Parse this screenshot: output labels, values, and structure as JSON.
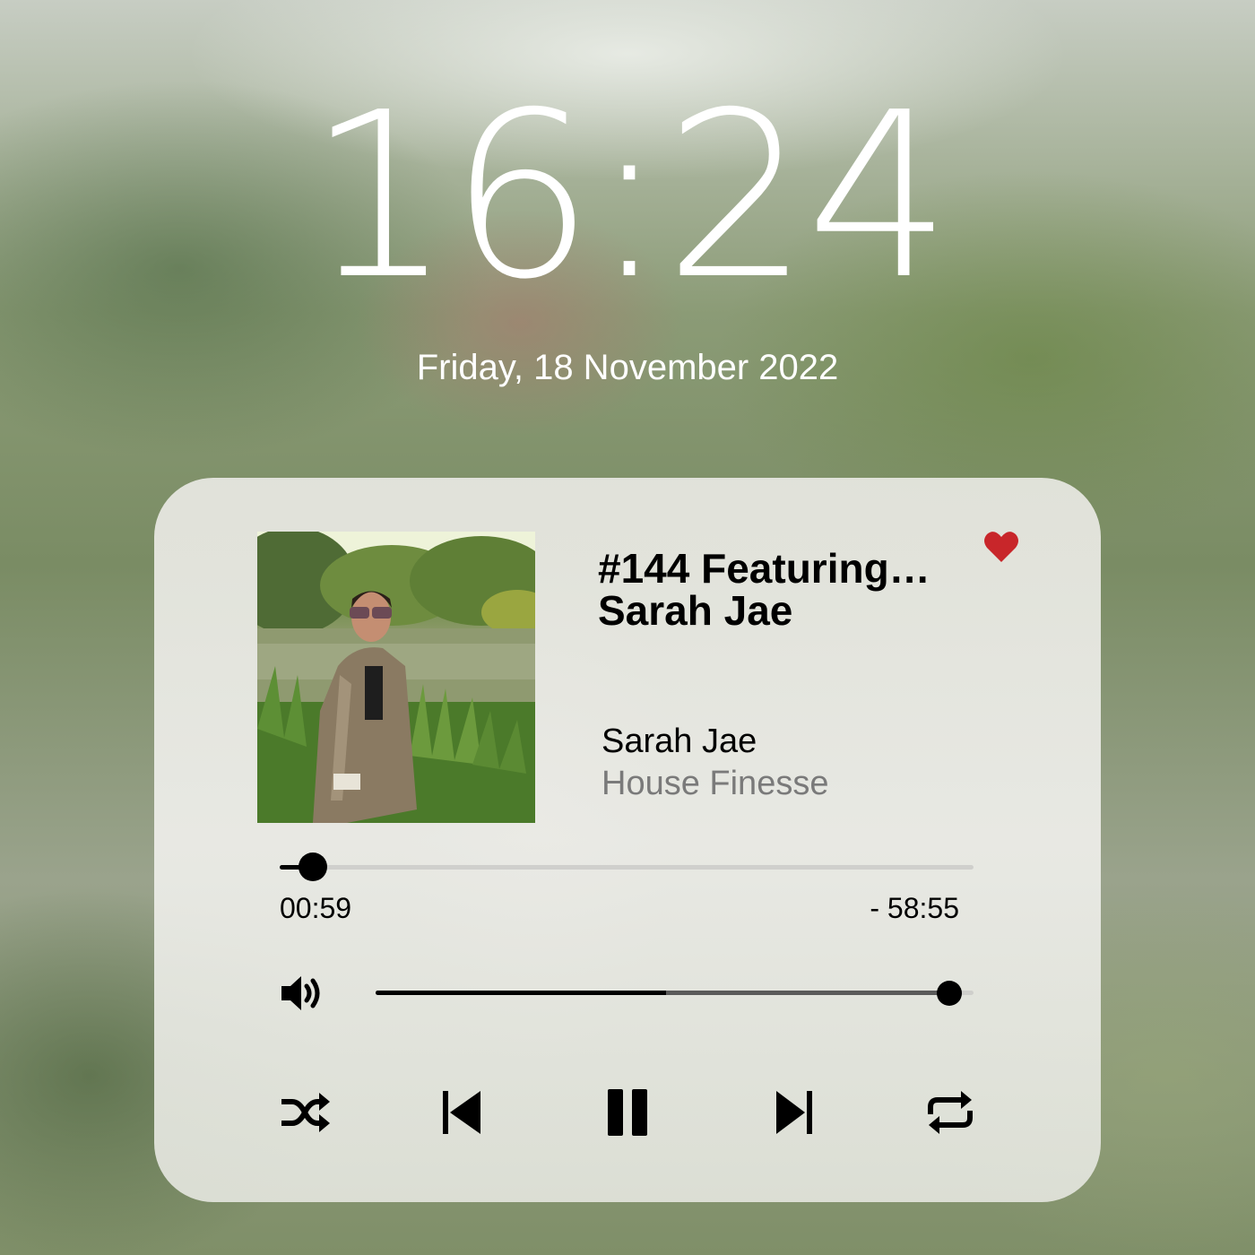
{
  "lockscreen": {
    "time": "16:24",
    "date": "Friday, 18 November 2022"
  },
  "player": {
    "title": "#144 Featuring… Sarah Jae",
    "artist": "Sarah Jae",
    "album": "House Finesse",
    "favorite": true,
    "elapsed": "00:59",
    "remaining": "- 58:55",
    "progress_fraction": 0.048,
    "volume_fraction": 0.96,
    "controls": {
      "shuffle": "shuffle-icon",
      "previous": "skip-back-icon",
      "play_pause": "pause-icon",
      "next": "skip-forward-icon",
      "repeat": "repeat-icon"
    }
  },
  "colors": {
    "heart": "#c8262a",
    "text_primary": "#000000",
    "text_secondary": "#7a7a7a",
    "track": "#cfcfcc"
  }
}
